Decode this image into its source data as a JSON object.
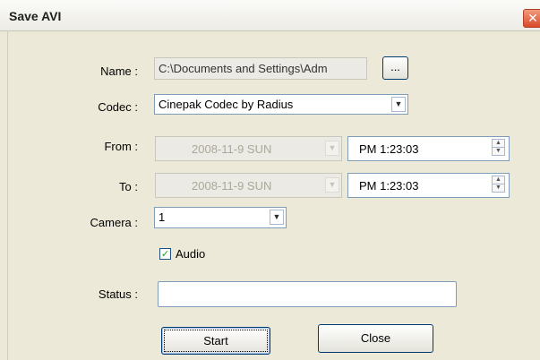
{
  "window": {
    "title": "Save AVI",
    "close_glyph": "✕"
  },
  "form": {
    "name": {
      "label": "Name :",
      "value": "C:\\Documents and Settings\\Adm",
      "browse_label": "..."
    },
    "codec": {
      "label": "Codec :",
      "value": "Cinepak Codec by Radius"
    },
    "from": {
      "label": "From :",
      "date": "2008-11-9   SUN",
      "time": "PM  1:23:03"
    },
    "to": {
      "label": "To :",
      "date": "2008-11-9   SUN",
      "time": "PM  1:23:03"
    },
    "camera": {
      "label": "Camera :",
      "value": "1"
    },
    "audio": {
      "label": "Audio",
      "checked": true
    },
    "status": {
      "label": "Status :",
      "value": ""
    }
  },
  "buttons": {
    "start": "Start",
    "close": "Close"
  },
  "icons": {
    "dropdown": "chevron-down-icon",
    "spin_up": "caret-up-icon",
    "spin_down": "caret-down-icon",
    "check": "check-icon"
  }
}
